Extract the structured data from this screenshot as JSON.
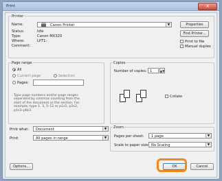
{
  "window": {
    "title": "Print",
    "close_glyph": "×"
  },
  "printer": {
    "section_label": "Printer",
    "name_label": "Name:",
    "name_value": "Canon Printer",
    "status_label": "Status:",
    "status_value": "Idle",
    "type_label": "Type:",
    "type_value": "Canon MX320",
    "where_label": "Where:",
    "where_value": "LPT1:",
    "comment_label": "Comment:",
    "properties_button": "Properties",
    "find_printer_button": "Find Printer...",
    "print_to_file_label": "Print to file",
    "manual_duplex_label": "Manual duplex",
    "icon": "printer-icon"
  },
  "page_range": {
    "section_label": "Page range",
    "all_label": "All",
    "current_page_label": "Current page",
    "selection_label": "Selection",
    "pages_label": "Pages:",
    "description": "Type page numbers and/or page ranges separated by commas counting from the start of the document or the section. For example, type 1, 3, 5–12 or p1s1, p1s2, p1s3–p8s3"
  },
  "copies": {
    "section_label": "Copies",
    "number_label": "Number of copies:",
    "number_value": "1",
    "collate_label": "Collate"
  },
  "print_what": {
    "label": "Print what:",
    "value": "Document",
    "print_label": "Print:",
    "print_value": "All pages in range"
  },
  "zoom": {
    "section_label": "Zoom",
    "pages_per_sheet_label": "Pages per sheet:",
    "pages_per_sheet_value": "1 page",
    "scale_label": "Scale to paper size:",
    "scale_value": "No Scaling"
  },
  "footer": {
    "options_button": "Options...",
    "ok_button": "OK",
    "cancel_button": "Cancel"
  },
  "colors": {
    "highlight": "#f08a1c"
  }
}
